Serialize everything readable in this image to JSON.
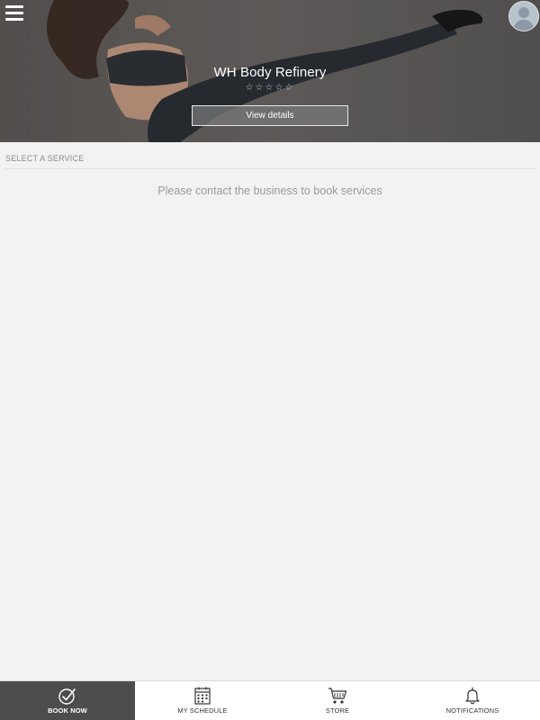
{
  "header": {
    "business_name": "WH Body Refinery",
    "rating_stars": "☆☆☆☆☆",
    "view_details_label": "View details"
  },
  "main": {
    "section_label": "SELECT A SERVICE",
    "empty_message": "Please contact the business to book services"
  },
  "bottom_nav": {
    "items": [
      {
        "label": "BOOK NOW",
        "icon": "check-circle-icon",
        "active": true
      },
      {
        "label": "MY SCHEDULE",
        "icon": "calendar-icon",
        "active": false
      },
      {
        "label": "STORE",
        "icon": "cart-icon",
        "active": false
      },
      {
        "label": "NOTIFICATIONS",
        "icon": "bell-icon",
        "active": false
      }
    ]
  },
  "colors": {
    "active_tab_bg": "#4d4d4d",
    "page_bg": "#f2f2f2",
    "hero_overlay": "#5a5a5a"
  }
}
